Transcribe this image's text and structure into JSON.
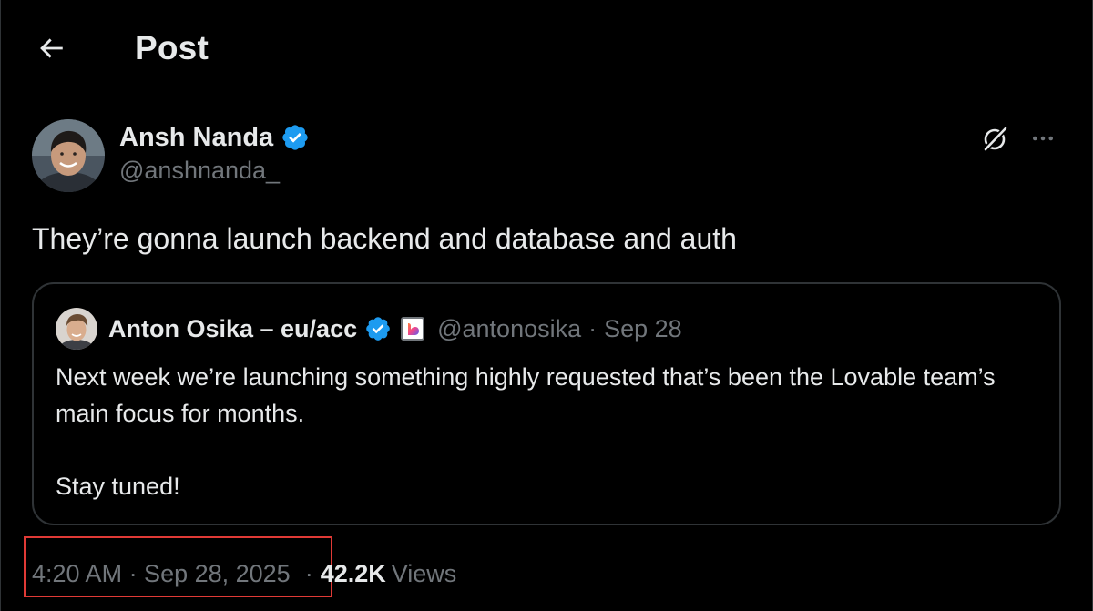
{
  "header": {
    "title": "Post",
    "back_icon": "arrow-left-icon"
  },
  "post": {
    "author": {
      "name": "Ansh Nanda",
      "handle": "@anshnanda_",
      "verified": true
    },
    "text": "They’re gonna launch backend and database and auth",
    "actions": {
      "grok_icon": "grok-icon",
      "more_icon": "more-icon"
    }
  },
  "quote": {
    "author": {
      "name": "Anton Osika – eu/acc",
      "handle": "@antonosika",
      "verified": true,
      "affiliation_icon": "lovable-logo-icon"
    },
    "separator": "·",
    "date": "Sep 28",
    "paragraphs": [
      "Next week we’re launching something highly requested that’s been the Lovable team’s main focus for months.",
      "Stay tuned!"
    ]
  },
  "meta": {
    "timestamp": "4:20 AM · Sep 28, 2025",
    "separator": "·",
    "views_count": "42.2K",
    "views_label": "Views"
  },
  "colors": {
    "background": "#000000",
    "text_primary": "#e7e9ea",
    "text_secondary": "#71767b",
    "verified_blue": "#1d9bf0",
    "border": "#2f3336",
    "highlight_red": "#e03a36"
  }
}
